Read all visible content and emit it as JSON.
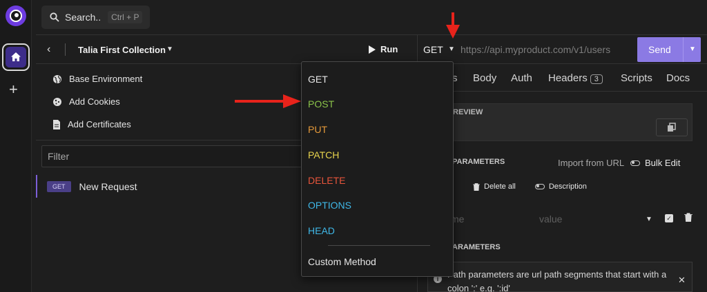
{
  "search": {
    "label": "Search..",
    "shortcut": "Ctrl + P"
  },
  "collection": {
    "title": "Talia First Collection",
    "run_label": "Run"
  },
  "sidebar_menu": [
    {
      "label": "Base Environment",
      "icon": "globe-icon"
    },
    {
      "label": "Add Cookies",
      "icon": "cookie-icon"
    },
    {
      "label": "Add Certificates",
      "icon": "certificate-icon"
    }
  ],
  "filter": {
    "placeholder": "Filter"
  },
  "request": {
    "method_badge": "GET",
    "name": "New Request"
  },
  "urlbar": {
    "method": "GET",
    "url": "https://api.myproduct.com/v1/users",
    "send_label": "Send"
  },
  "tabs": [
    {
      "label": "s"
    },
    {
      "label": "Body"
    },
    {
      "label": "Auth"
    },
    {
      "label": "Headers",
      "count": "3"
    },
    {
      "label": "Scripts"
    },
    {
      "label": "Docs"
    }
  ],
  "preview": {
    "label": "REVIEW"
  },
  "query_params": {
    "label": "PARAMETERS",
    "import_label": "Import from URL",
    "bulk_label": "Bulk Edit",
    "delete_all_label": "Delete all",
    "description_label": "Description",
    "name_placeholder": "me",
    "value_placeholder": "value"
  },
  "path_params": {
    "label": "ARAMETERS",
    "info_text": "Path parameters are url path segments that start with a colon ':' e.g. ':id'"
  },
  "method_dropdown": [
    {
      "label": "GET",
      "color": "#e6e6e6"
    },
    {
      "label": "POST",
      "color": "#8bc34a"
    },
    {
      "label": "PUT",
      "color": "#e69a3a"
    },
    {
      "label": "PATCH",
      "color": "#e8d44d"
    },
    {
      "label": "DELETE",
      "color": "#e8553b"
    },
    {
      "label": "OPTIONS",
      "color": "#3fb8e8"
    },
    {
      "label": "HEAD",
      "color": "#3fb8e8"
    },
    {
      "label": "Custom Method",
      "color": "#e6e6e6"
    }
  ],
  "colors": {
    "accent": "#8b7ae4",
    "arrow": "#e8231b"
  }
}
